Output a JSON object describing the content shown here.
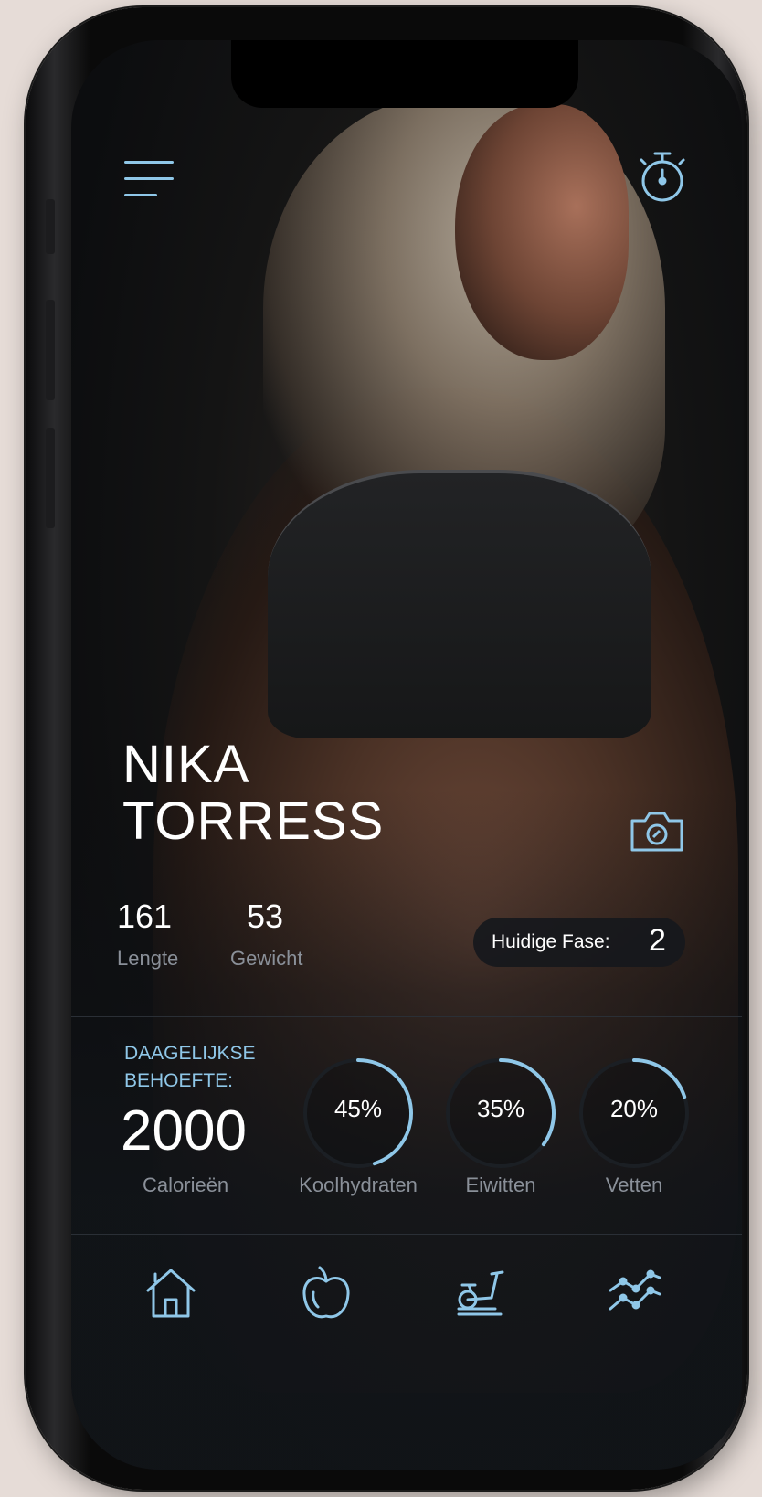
{
  "profile": {
    "first_name": "NIKA",
    "last_name": "TORRESS",
    "height_value": "161",
    "height_label": "Lengte",
    "weight_value": "53",
    "weight_label": "Gewicht"
  },
  "phase": {
    "label": "Huidige Fase:",
    "value": "2"
  },
  "daily": {
    "heading_line1": "DAAGELIJKSE",
    "heading_line2": "BEHOEFTE:",
    "calories_value": "2000",
    "calories_label": "Calorieën"
  },
  "macros": [
    {
      "label": "Koolhydraten",
      "percent": "45%",
      "fraction": 0.45
    },
    {
      "label": "Eiwitten",
      "percent": "35%",
      "fraction": 0.35
    },
    {
      "label": "Vetten",
      "percent": "20%",
      "fraction": 0.2
    }
  ],
  "icons": {
    "top_left": "menu-icon",
    "top_right": "stopwatch-icon",
    "profile_action": "camera-icon",
    "nav": [
      "home-icon",
      "apple-icon",
      "exercise-bike-icon",
      "progress-chart-icon"
    ]
  },
  "colors": {
    "accent": "#8fc7e8",
    "background": "#111418",
    "muted_text": "#8a9099"
  }
}
